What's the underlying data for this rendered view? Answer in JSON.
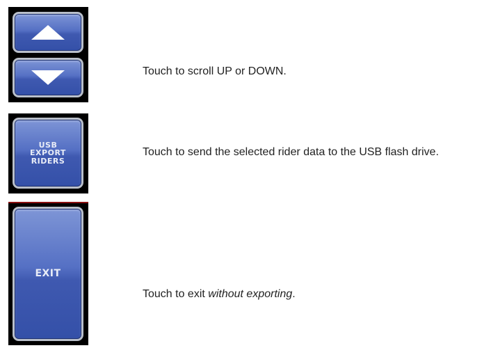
{
  "rows": [
    {
      "description": "Touch to scroll UP or DOWN.",
      "buttons": [
        {
          "name": "scroll-up-button",
          "icon": "arrow-up-icon"
        },
        {
          "name": "scroll-down-button",
          "icon": "arrow-down-icon"
        }
      ]
    },
    {
      "description": "Touch to send the selected rider data to the USB flash drive.",
      "button_label_lines": [
        "USB",
        "EXPORT",
        "RIDERS"
      ]
    },
    {
      "description_prefix": "Touch to exit ",
      "description_emphasis": "without exporting",
      "description_suffix": ".",
      "button_label": "EXIT"
    }
  ],
  "colors": {
    "button_blue": "#4a63b8",
    "button_border": "#b9bfca",
    "panel_background": "#000000",
    "text": "#222222"
  }
}
